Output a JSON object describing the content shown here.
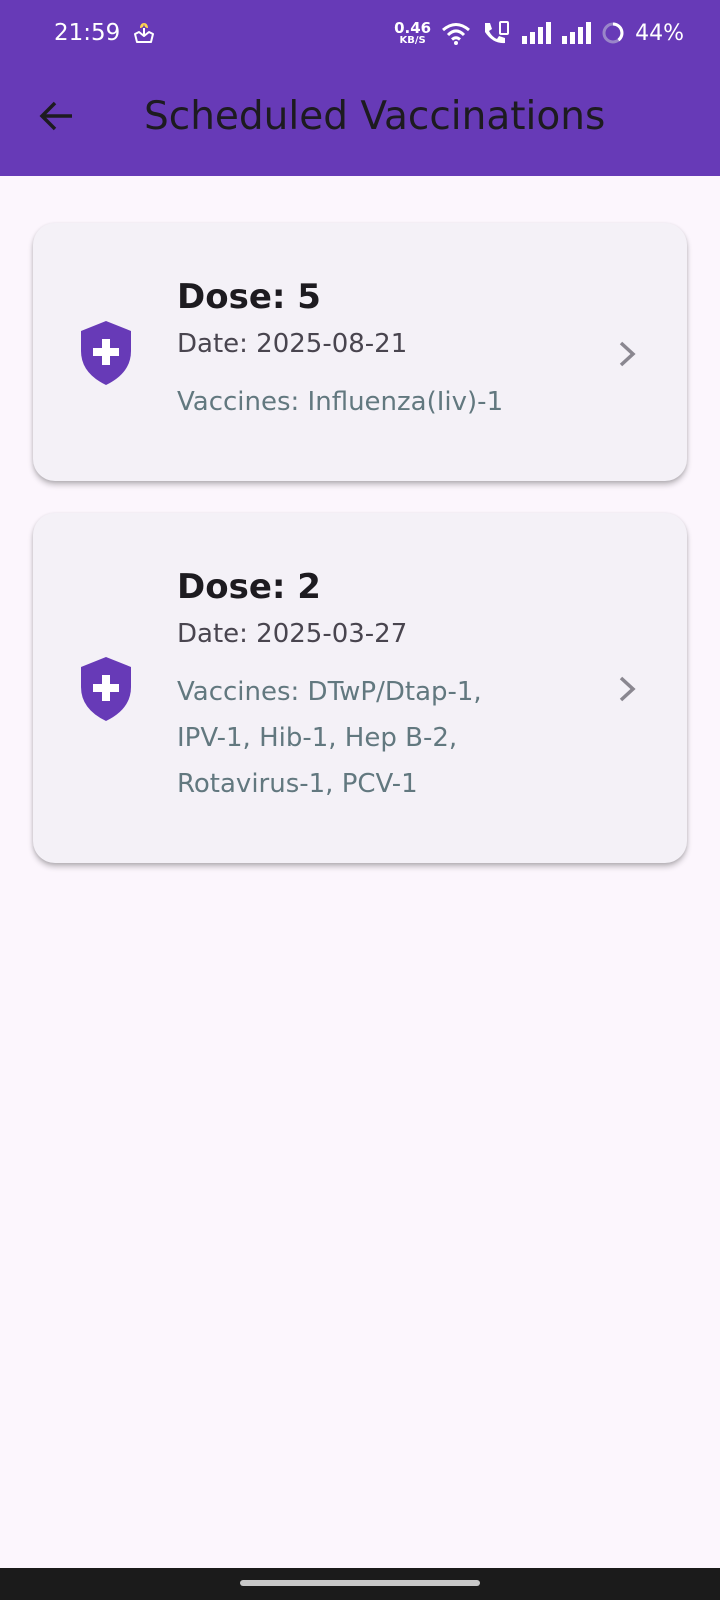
{
  "status_bar": {
    "time": "21:59",
    "net_speed_value": "0.46",
    "net_speed_unit": "KB/S",
    "battery": "44%",
    "icons": [
      "hand-plant-icon",
      "wifi-icon",
      "wifi-calling-icon",
      "signal-icon",
      "signal-icon",
      "battery-ring-icon"
    ]
  },
  "app_bar": {
    "title": "Scheduled Vaccinations",
    "back_icon": "arrow-back-icon",
    "color": "#673ab7"
  },
  "schedules": [
    {
      "dose": "Dose: 5",
      "date": "Date: 2025-08-21",
      "vaccines_lines": [
        "Vaccines: Influenza(Iiv)-1"
      ],
      "icon": "shield-plus-icon"
    },
    {
      "dose": "Dose: 2",
      "date": "Date: 2025-03-27",
      "vaccines_lines": [
        "Vaccines: DTwP/Dtap-1,",
        "IPV-1, Hib-1, Hep B-2,",
        "Rotavirus-1, PCV-1"
      ],
      "icon": "shield-plus-icon"
    }
  ],
  "colors": {
    "accent": "#673ab7",
    "background": "#fcf6fd",
    "card": "#f4f1f7",
    "vaccines_text": "#62787f"
  }
}
